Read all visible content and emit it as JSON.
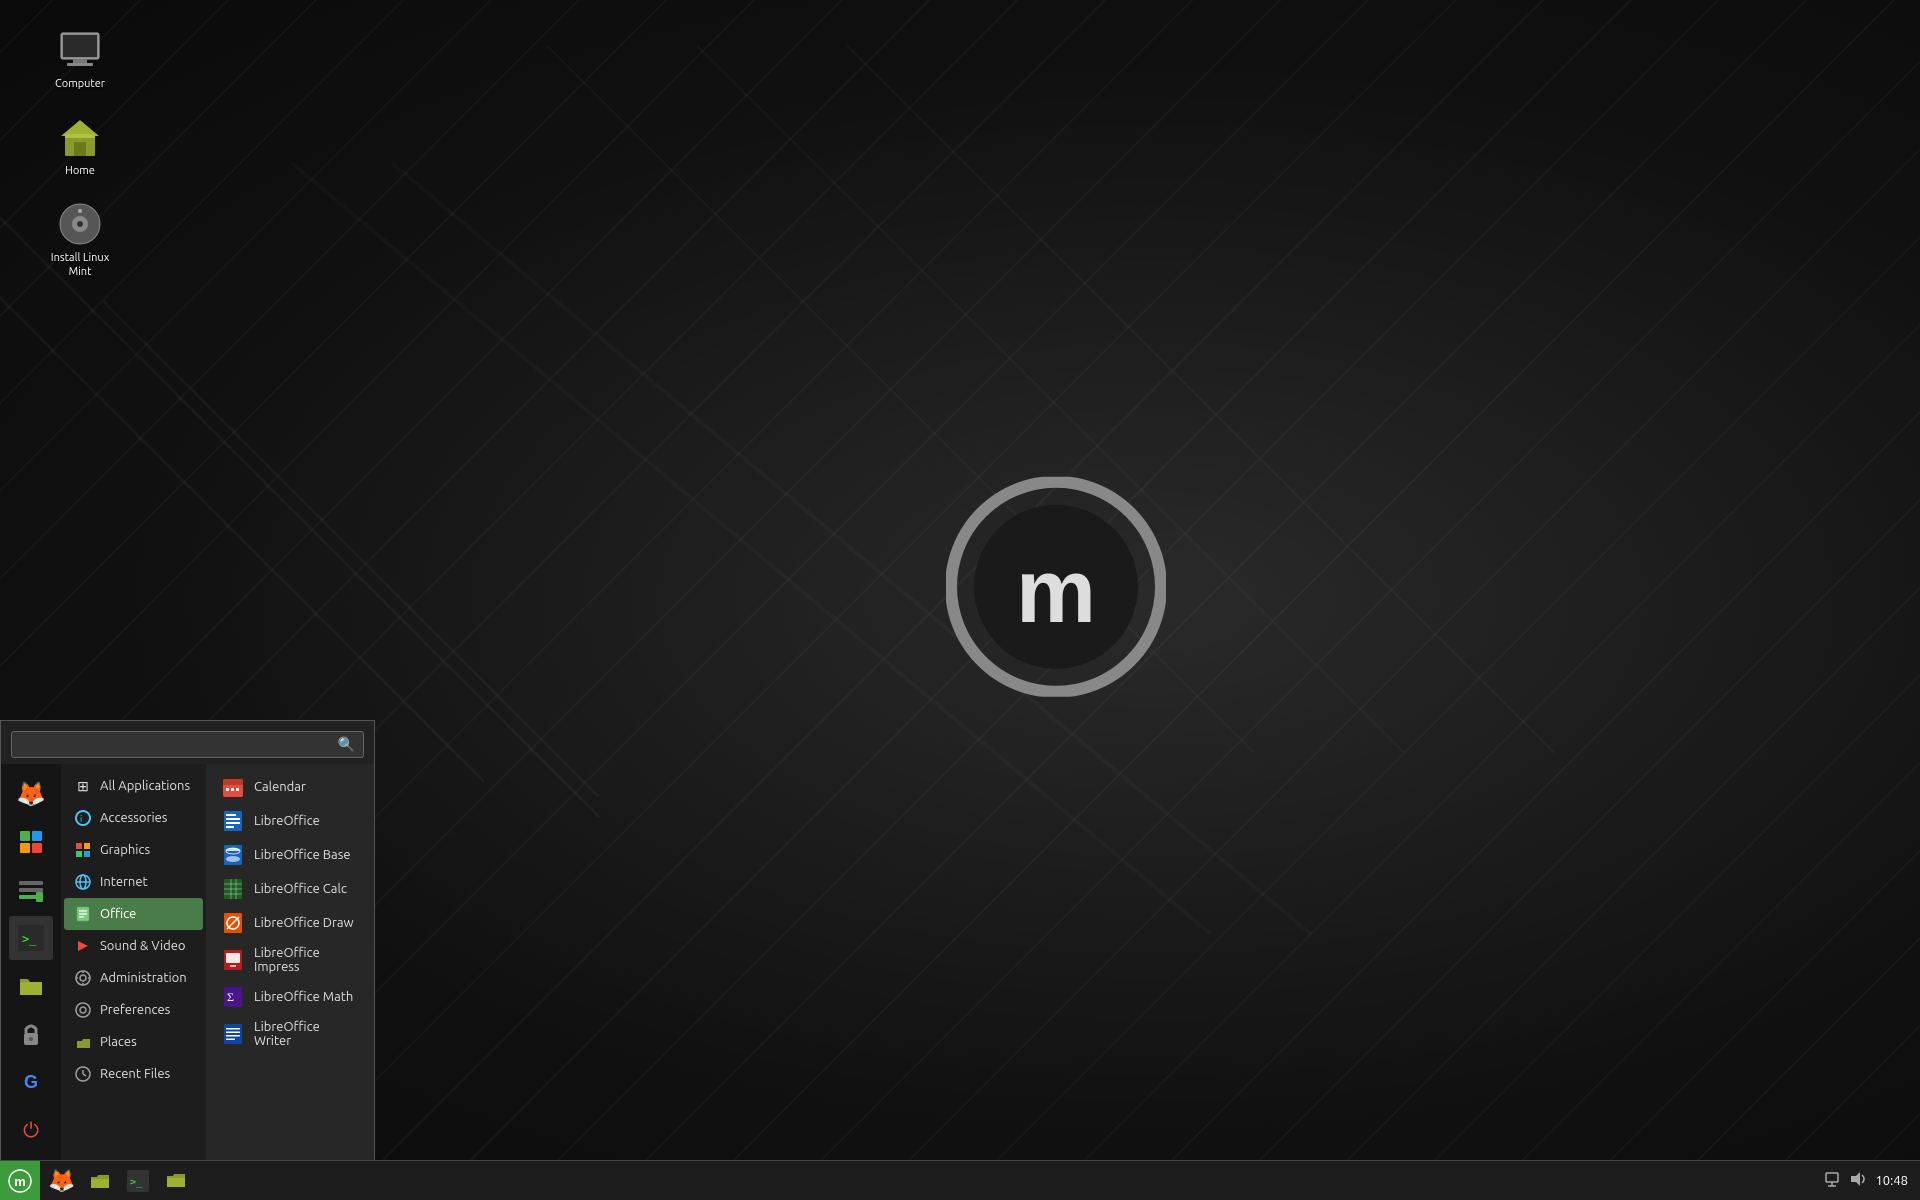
{
  "desktop": {
    "icons": [
      {
        "id": "computer",
        "label": "Computer",
        "icon": "🖥️"
      },
      {
        "id": "home",
        "label": "Home",
        "icon": "🏠"
      },
      {
        "id": "install",
        "label": "Install Linux Mint",
        "icon": "💿"
      }
    ]
  },
  "taskbar": {
    "start_icon": "🌿",
    "items": [
      {
        "id": "mintmenu",
        "icon": "🦊"
      },
      {
        "id": "files",
        "icon": "📁"
      },
      {
        "id": "terminal",
        "icon": "⬛"
      },
      {
        "id": "folder",
        "icon": "📂"
      }
    ],
    "tray": {
      "network": "🌐",
      "sound": "🔊",
      "time": "10:48"
    }
  },
  "start_menu": {
    "search": {
      "placeholder": "",
      "value": ""
    },
    "sidebar_icons": [
      {
        "id": "firefox",
        "icon": "🦊"
      },
      {
        "id": "software",
        "icon": "🔳"
      },
      {
        "id": "manager",
        "icon": "🗂️"
      },
      {
        "id": "terminal",
        "icon": "⬛"
      },
      {
        "id": "files",
        "icon": "📁"
      },
      {
        "id": "lock",
        "icon": "🔒"
      },
      {
        "id": "google",
        "icon": "G"
      },
      {
        "id": "power",
        "icon": "⏻"
      }
    ],
    "categories": [
      {
        "id": "all",
        "label": "All Applications",
        "icon": "⊞",
        "active": false
      },
      {
        "id": "accessories",
        "label": "Accessories",
        "icon": "🔧",
        "active": false
      },
      {
        "id": "graphics",
        "label": "Graphics",
        "icon": "🎨",
        "active": false
      },
      {
        "id": "internet",
        "label": "Internet",
        "icon": "🌐",
        "active": false
      },
      {
        "id": "office",
        "label": "Office",
        "icon": "📄",
        "active": true
      },
      {
        "id": "sound-video",
        "label": "Sound & Video",
        "icon": "▶️",
        "active": false
      },
      {
        "id": "administration",
        "label": "Administration",
        "icon": "⚙️",
        "active": false
      },
      {
        "id": "preferences",
        "label": "Preferences",
        "icon": "🔧",
        "active": false
      },
      {
        "id": "places",
        "label": "Places",
        "icon": "📁",
        "active": false
      },
      {
        "id": "recent",
        "label": "Recent Files",
        "icon": "🕐",
        "active": false
      }
    ],
    "apps": [
      {
        "id": "calendar",
        "label": "Calendar",
        "color": "#e74c3c"
      },
      {
        "id": "libreoffice",
        "label": "LibreOffice",
        "color": "#2980b9"
      },
      {
        "id": "libreoffice-base",
        "label": "LibreOffice Base",
        "color": "#2980b9"
      },
      {
        "id": "libreoffice-calc",
        "label": "LibreOffice Calc",
        "color": "#27ae60"
      },
      {
        "id": "libreoffice-draw",
        "label": "LibreOffice Draw",
        "color": "#e67e22"
      },
      {
        "id": "libreoffice-impress",
        "label": "LibreOffice Impress",
        "color": "#e74c3c"
      },
      {
        "id": "libreoffice-math",
        "label": "LibreOffice Math",
        "color": "#8e44ad"
      },
      {
        "id": "libreoffice-writer",
        "label": "LibreOffice Writer",
        "color": "#2980b9"
      }
    ]
  }
}
